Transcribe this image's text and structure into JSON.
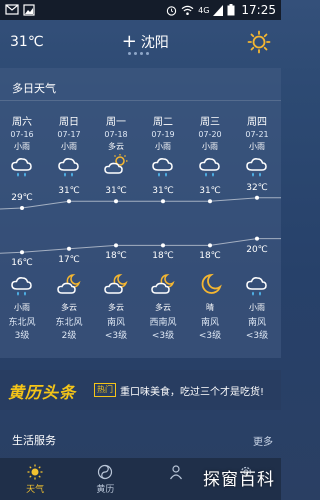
{
  "status_bar": {
    "time": "17:25",
    "network": "4G"
  },
  "header": {
    "temp": "31℃",
    "city": "沈阳",
    "add_symbol": "+"
  },
  "section": {
    "title": "多日天气"
  },
  "days": [
    {
      "name": "周六",
      "date": "07-16",
      "day_cond": "小雨",
      "day_icon": "rain-cloud-icon",
      "high": "29℃",
      "low": "16℃",
      "night_cond": "小雨",
      "night_icon": "rain-cloud-icon",
      "wind": "东北风",
      "level": "3级"
    },
    {
      "name": "周日",
      "date": "07-17",
      "day_cond": "小雨",
      "day_icon": "rain-cloud-icon",
      "high": "31℃",
      "low": "17℃",
      "night_cond": "多云",
      "night_icon": "cloudy-night-icon",
      "wind": "东北风",
      "level": "2级"
    },
    {
      "name": "周一",
      "date": "07-18",
      "day_cond": "多云",
      "day_icon": "partly-cloudy-icon",
      "high": "31℃",
      "low": "18℃",
      "night_cond": "多云",
      "night_icon": "cloudy-night-icon",
      "wind": "南风",
      "level": "<3级"
    },
    {
      "name": "周二",
      "date": "07-19",
      "day_cond": "小雨",
      "day_icon": "rain-cloud-icon",
      "high": "31℃",
      "low": "18℃",
      "night_cond": "多云",
      "night_icon": "cloudy-night-icon",
      "wind": "西南风",
      "level": "<3级"
    },
    {
      "name": "周三",
      "date": "07-20",
      "day_cond": "小雨",
      "day_icon": "rain-cloud-icon",
      "high": "31℃",
      "low": "18℃",
      "night_cond": "晴",
      "night_icon": "moon-icon",
      "wind": "南风",
      "level": "<3级"
    },
    {
      "name": "周四",
      "date": "07-21",
      "day_cond": "小雨",
      "day_icon": "rain-cloud-icon",
      "high": "32℃",
      "low": "20℃",
      "night_cond": "小雨",
      "night_icon": "rain-cloud-icon",
      "wind": "南风",
      "level": "<3级"
    }
  ],
  "chart_data": {
    "type": "line",
    "categories": [
      "周六",
      "周日",
      "周一",
      "周二",
      "周三",
      "周四"
    ],
    "series": [
      {
        "values": [
          29,
          31,
          31,
          31,
          31,
          32
        ]
      },
      {
        "values": [
          16,
          17,
          18,
          18,
          18,
          20
        ]
      }
    ]
  },
  "ad": {
    "logo": "黄历头条",
    "tag": "热门",
    "text": "重口味美食，吃过三个才是吃货!"
  },
  "life": {
    "title": "生活服务",
    "more": "更多"
  },
  "tabs": [
    {
      "label": "天气",
      "icon": "sun-icon",
      "active": true
    },
    {
      "label": "黄历",
      "icon": "yin-yang-icon",
      "active": false
    },
    {
      "label": "",
      "icon": "person-icon",
      "active": false
    },
    {
      "label": "",
      "icon": "gear-icon",
      "active": false
    }
  ],
  "watermark": "探窗百科",
  "colors": {
    "accent": "#f2c230",
    "sun": "#f5b731",
    "rain": "#4fb2e8"
  }
}
